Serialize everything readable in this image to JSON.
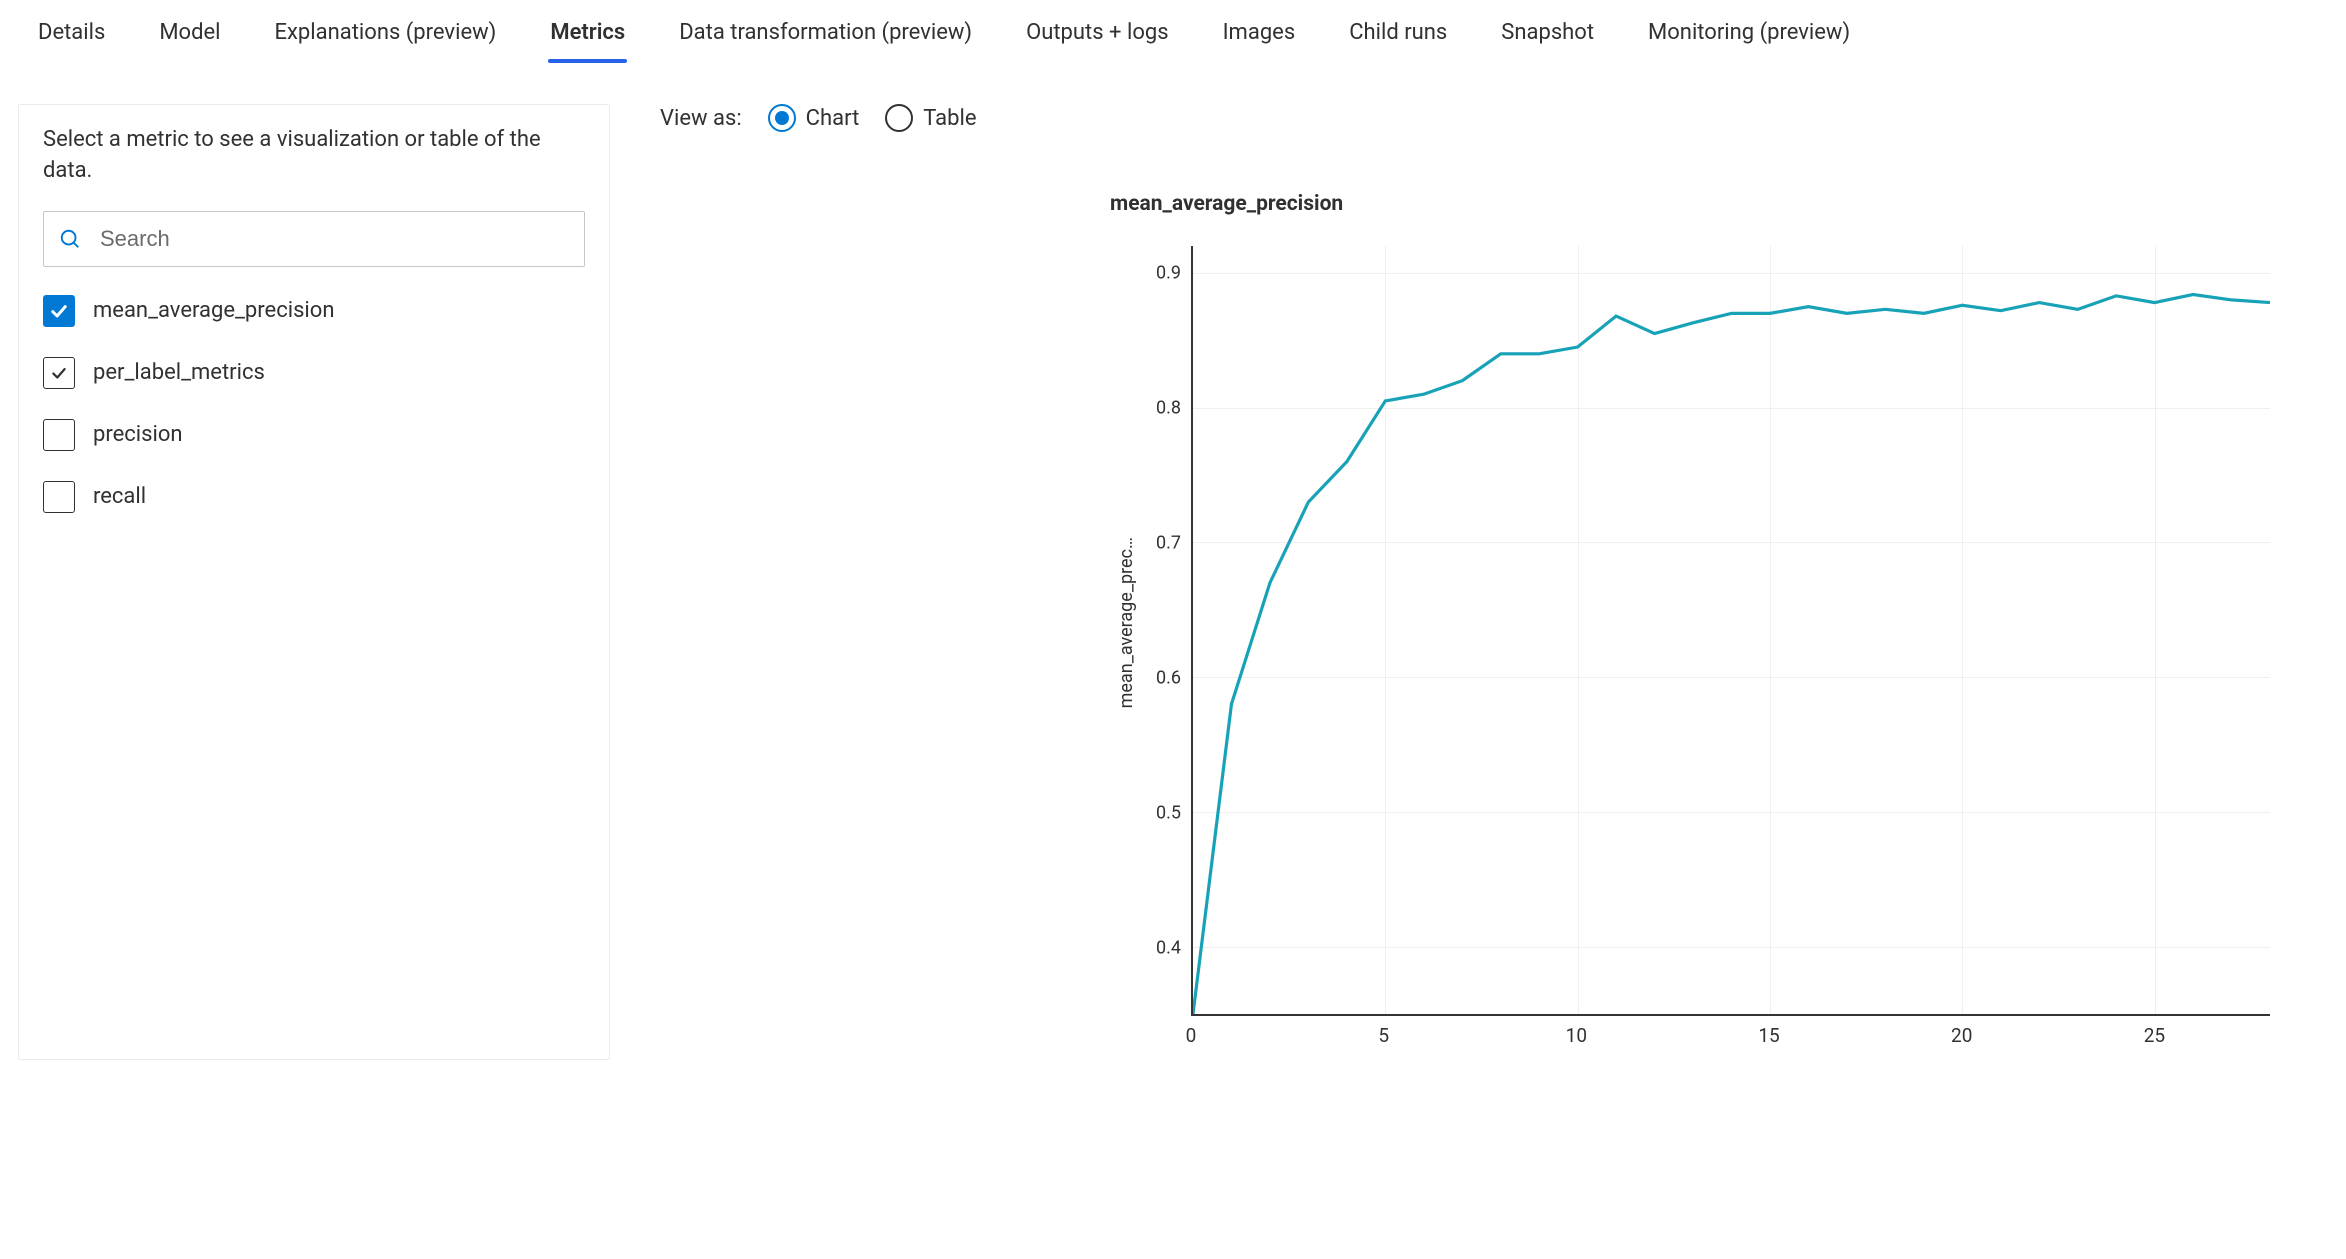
{
  "tabs": [
    {
      "label": "Details",
      "active": false
    },
    {
      "label": "Model",
      "active": false
    },
    {
      "label": "Explanations (preview)",
      "active": false
    },
    {
      "label": "Metrics",
      "active": true
    },
    {
      "label": "Data transformation (preview)",
      "active": false
    },
    {
      "label": "Outputs + logs",
      "active": false
    },
    {
      "label": "Images",
      "active": false
    },
    {
      "label": "Child runs",
      "active": false
    },
    {
      "label": "Snapshot",
      "active": false
    },
    {
      "label": "Monitoring (preview)",
      "active": false
    }
  ],
  "sidebar": {
    "description": "Select a metric to see a visualization or table of the data.",
    "search_placeholder": "Search",
    "metrics": [
      {
        "label": "mean_average_precision",
        "state": "checked"
      },
      {
        "label": "per_label_metrics",
        "state": "indeterminate"
      },
      {
        "label": "precision",
        "state": "unchecked"
      },
      {
        "label": "recall",
        "state": "unchecked"
      }
    ]
  },
  "viewas": {
    "label": "View as:",
    "options": [
      {
        "label": "Chart",
        "selected": true
      },
      {
        "label": "Table",
        "selected": false
      }
    ]
  },
  "chart_data": {
    "type": "line",
    "title": "mean_average_precision",
    "ylabel": "mean_average_prec…",
    "xlabel": "",
    "xlim": [
      0,
      28
    ],
    "ylim": [
      0.35,
      0.92
    ],
    "xticks": [
      0,
      5,
      10,
      15,
      20,
      25
    ],
    "yticks": [
      0.4,
      0.5,
      0.6,
      0.7,
      0.8,
      0.9
    ],
    "series": [
      {
        "name": "mean_average_precision",
        "color": "#17a2b8",
        "x": [
          0,
          1,
          2,
          3,
          4,
          5,
          6,
          7,
          8,
          9,
          10,
          11,
          12,
          13,
          14,
          15,
          16,
          17,
          18,
          19,
          20,
          21,
          22,
          23,
          24,
          25,
          26,
          27,
          28
        ],
        "y": [
          0.35,
          0.58,
          0.67,
          0.73,
          0.76,
          0.805,
          0.81,
          0.82,
          0.84,
          0.84,
          0.845,
          0.868,
          0.855,
          0.863,
          0.87,
          0.87,
          0.875,
          0.87,
          0.873,
          0.87,
          0.876,
          0.872,
          0.878,
          0.873,
          0.883,
          0.878,
          0.884,
          0.88,
          0.878
        ]
      }
    ]
  }
}
